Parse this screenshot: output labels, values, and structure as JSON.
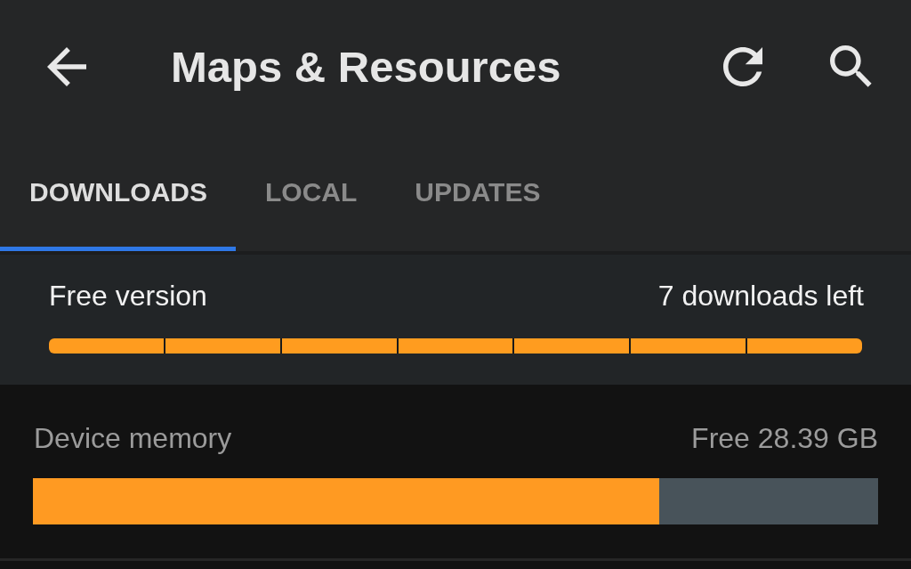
{
  "app_bar": {
    "title": "Maps & Resources"
  },
  "tabs": [
    {
      "label": "DOWNLOADS",
      "selected": true
    },
    {
      "label": "LOCAL",
      "selected": false
    },
    {
      "label": "UPDATES",
      "selected": false
    }
  ],
  "plan": {
    "label": "Free version",
    "downloads_left": "7 downloads left",
    "segments": [
      {
        "filled": true
      },
      {
        "filled": true
      },
      {
        "filled": true
      },
      {
        "filled": true
      },
      {
        "filled": true
      },
      {
        "filled": true
      },
      {
        "filled": true
      }
    ]
  },
  "storage": {
    "label": "Device memory",
    "free": "Free 28.39 GB",
    "level": 0.741
  }
}
